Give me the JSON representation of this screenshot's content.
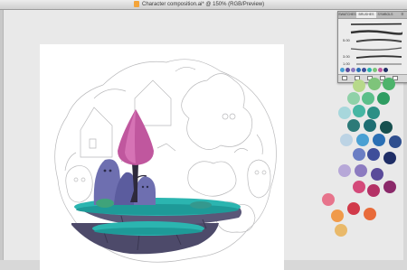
{
  "window": {
    "title": "Character composition.ai* @ 150% (RGB/Preview)"
  },
  "brushes_panel": {
    "tabs": [
      {
        "label": "SWATCHES",
        "active": false
      },
      {
        "label": "BRUSHES",
        "active": true
      },
      {
        "label": "SYMBOLS",
        "active": false
      }
    ],
    "menu_icon": "panel-menu-icon",
    "brushes": [
      {
        "value": ""
      },
      {
        "value": ""
      },
      {
        "value": "5.00"
      },
      {
        "value": ""
      },
      {
        "value": "3.00"
      },
      {
        "value": "1.00"
      }
    ],
    "bottom_icons": [
      "brush-libraries-icon",
      "remove-stroke-icon",
      "brush-options-icon",
      "new-brush-icon",
      "delete-brush-icon"
    ]
  },
  "color_palette": {
    "colors": [
      "#b7d98a",
      "#7ec47a",
      "#4db36b",
      "#8fd1a8",
      "#5cbf8a",
      "#2f9d62",
      "#a7d7dc",
      "#46b6a3",
      "#2b8f85",
      "#2c7a78",
      "#1e6e73",
      "#17504f",
      "#bcd3e4",
      "#4aa0d3",
      "#2a6fb4",
      "#2f4f8e",
      "#1f2e66",
      "#6a7ec4",
      "#3e4e9a",
      "#b7a8d8",
      "#8c7bc0",
      "#5a4b9a",
      "#8b2a6a",
      "#e7748c",
      "#d44a7a",
      "#b43266",
      "#f09a4a",
      "#e86b3a",
      "#d13a4a",
      "#e9b96a"
    ]
  },
  "illustration": {
    "platform_color": "#2bb5b0",
    "rock_color": "#4d4a6a",
    "tree_color": "#c0579e"
  }
}
